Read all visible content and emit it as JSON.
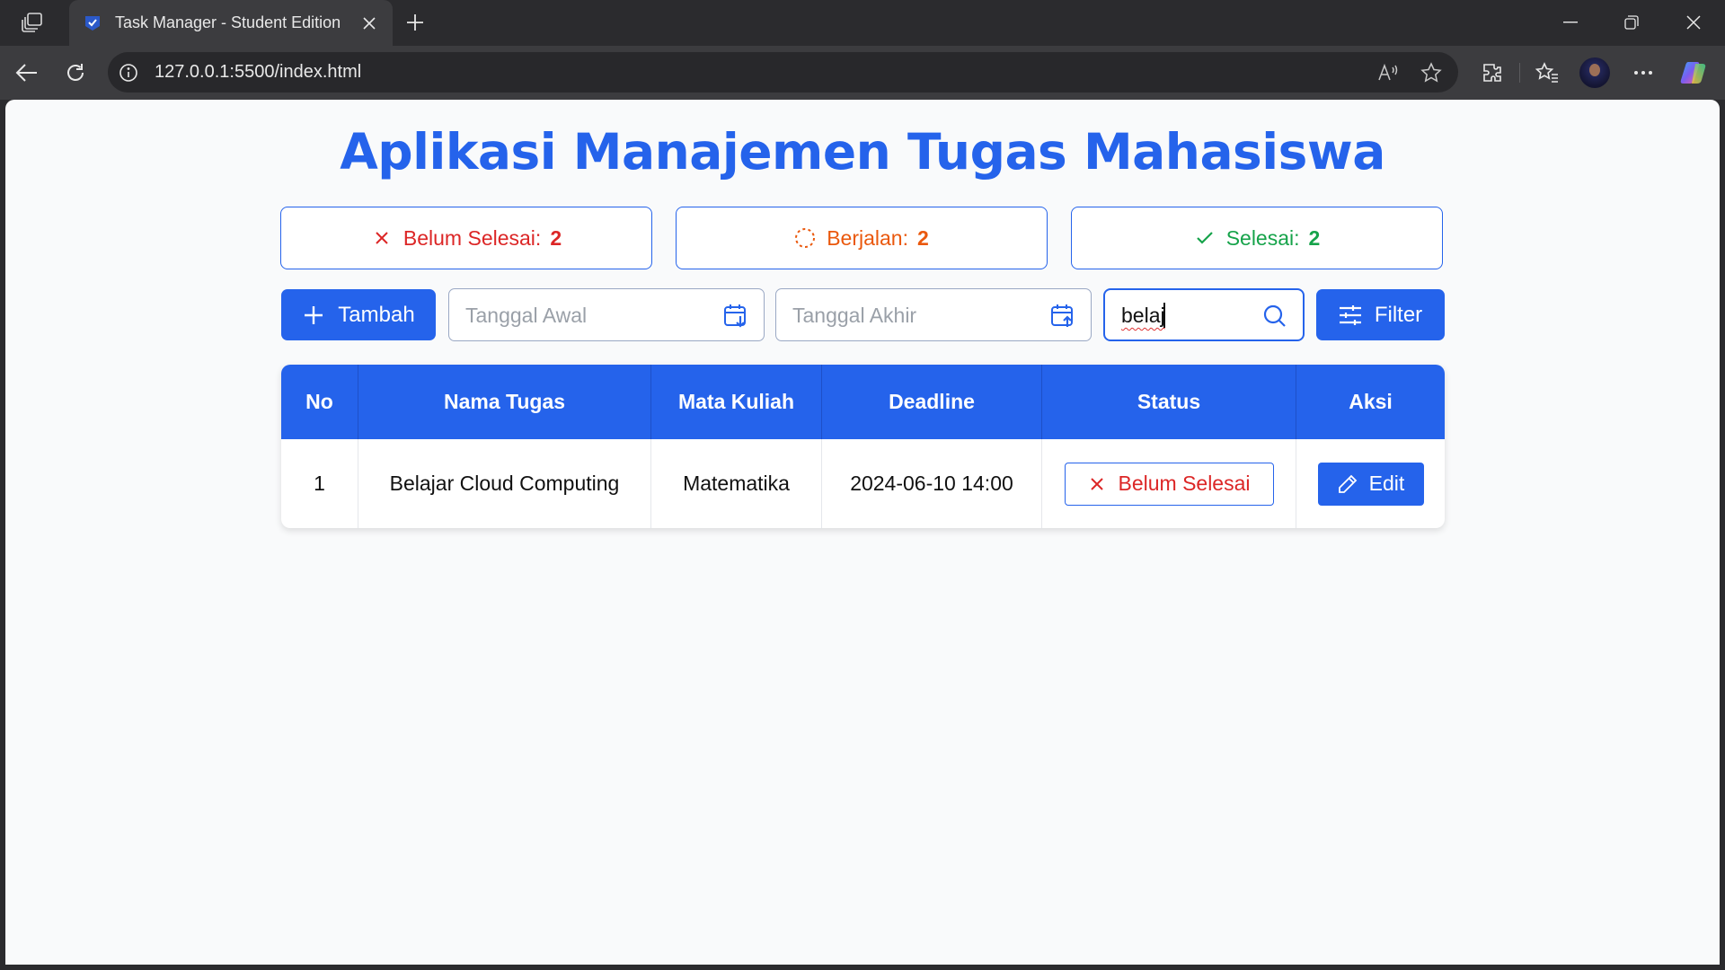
{
  "browser": {
    "tab_title": "Task Manager - Student Edition",
    "url": "127.0.0.1:5500/index.html"
  },
  "page": {
    "title": "Aplikasi Manajemen Tugas Mahasiswa",
    "stats": [
      {
        "label": "Belum Selesai:",
        "count": "2",
        "icon": "x-icon",
        "color": "#dc2626"
      },
      {
        "label": "Berjalan:",
        "count": "2",
        "icon": "spinner-icon",
        "color": "#ea580c"
      },
      {
        "label": "Selesai:",
        "count": "2",
        "icon": "check-icon",
        "color": "#16a34a"
      }
    ],
    "controls": {
      "add_label": "Tambah",
      "start_date_placeholder": "Tanggal Awal",
      "end_date_placeholder": "Tanggal Akhir",
      "search_value": "belaj",
      "filter_label": "Filter"
    },
    "table": {
      "headers": [
        "No",
        "Nama Tugas",
        "Mata Kuliah",
        "Deadline",
        "Status",
        "Aksi"
      ],
      "rows": [
        {
          "no": "1",
          "name": "Belajar Cloud Computing",
          "course": "Matematika",
          "deadline": "2024-06-10 14:00",
          "status": "Belum Selesai",
          "action": "Edit"
        }
      ]
    }
  },
  "colors": {
    "accent": "#2563eb",
    "danger": "#dc2626",
    "warning": "#ea580c",
    "success": "#16a34a"
  }
}
